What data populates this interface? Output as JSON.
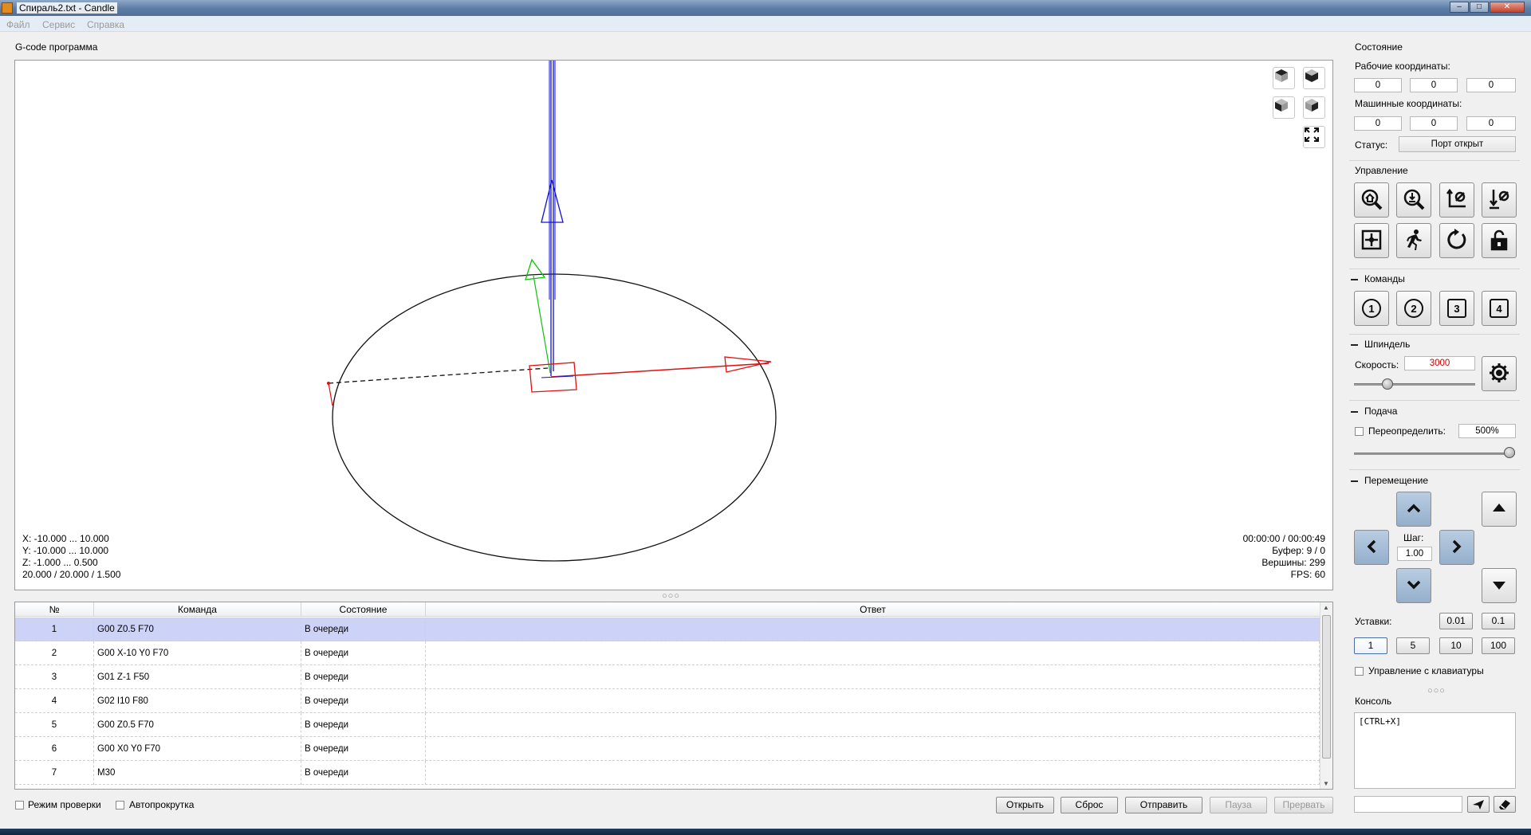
{
  "window": {
    "title": "Спираль2.txt - Candle",
    "minimize": "‒",
    "maximize": "□",
    "close": "✕"
  },
  "menu": [
    "Файл",
    "Сервис",
    "Справка"
  ],
  "program": {
    "group_title": "G-code программа",
    "info_left": [
      "X: -10.000 ... 10.000",
      "Y: -10.000 ... 10.000",
      "Z: -1.000 ... 0.500",
      "20.000 / 20.000 / 1.500"
    ],
    "info_right": [
      "00:00:00 / 00:00:49",
      "Буфер: 9 / 0",
      "Вершины: 299",
      "FPS: 60"
    ],
    "table": {
      "headers": [
        "№",
        "Команда",
        "Состояние",
        "Ответ"
      ],
      "rows": [
        {
          "num": "1",
          "cmd": "G00 Z0.5 F70",
          "state": "В очереди",
          "resp": ""
        },
        {
          "num": "2",
          "cmd": "G00 X-10 Y0 F70",
          "state": "В очереди",
          "resp": ""
        },
        {
          "num": "3",
          "cmd": "G01 Z-1 F50",
          "state": "В очереди",
          "resp": ""
        },
        {
          "num": "4",
          "cmd": "G02 I10 F80",
          "state": "В очереди",
          "resp": ""
        },
        {
          "num": "5",
          "cmd": "G00 Z0.5 F70",
          "state": "В очереди",
          "resp": ""
        },
        {
          "num": "6",
          "cmd": "G00 X0 Y0 F70",
          "state": "В очереди",
          "resp": ""
        },
        {
          "num": "7",
          "cmd": "M30",
          "state": "В очереди",
          "resp": ""
        }
      ]
    },
    "check_mode": "Режим проверки",
    "autoscroll": "Автопрокрутка",
    "buttons": {
      "open": "Открыть",
      "reset": "Сброс",
      "send": "Отправить",
      "pause": "Пауза",
      "abort": "Прервать"
    }
  },
  "state": {
    "title": "Состояние",
    "work_coords_label": "Рабочие координаты:",
    "work_coords": [
      "0",
      "0",
      "0"
    ],
    "machine_coords_label": "Машинные координаты:",
    "machine_coords": [
      "0",
      "0",
      "0"
    ],
    "status_label": "Статус:",
    "status_value": "Порт открыт"
  },
  "control": {
    "title": "Управление"
  },
  "commands": {
    "title": "Команды",
    "items": [
      "1",
      "2",
      "3",
      "4"
    ]
  },
  "spindle": {
    "title": "Шпиндель",
    "speed_label": "Скорость:",
    "speed_value": "3000",
    "slider_fraction": 0.25
  },
  "feed": {
    "title": "Подача",
    "override_label": "Переопределить:",
    "override_value": "500%",
    "slider_fraction": 1.0
  },
  "jog": {
    "title": "Перемещение",
    "step_label": "Шаг:",
    "step_value": "1.00",
    "presets_label": "Уставки:",
    "presets_row1": [
      "0.01",
      "0.1"
    ],
    "presets_row2": [
      "1",
      "5",
      "10",
      "100"
    ],
    "keyboard_label": "Управление с клавиатуры"
  },
  "console": {
    "title": "Консоль",
    "text": "[CTRL+X]"
  },
  "colors": {
    "axis_x": "#e01010",
    "axis_y": "#10d010",
    "axis_z": "#1010d0",
    "spindle_speed": "#cc0000",
    "selected_row": "#cdd2f7"
  }
}
